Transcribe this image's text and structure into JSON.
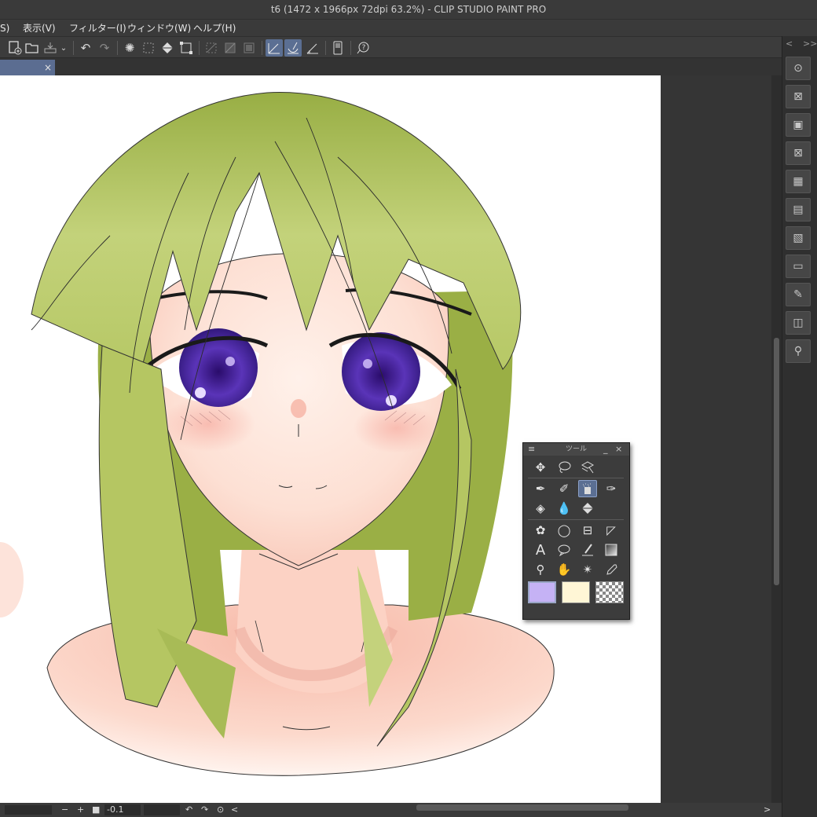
{
  "window": {
    "title": "t6 (1472 x 1966px 72dpi 63.2%)  - CLIP STUDIO PAINT PRO"
  },
  "menu": {
    "partial_first": "S)",
    "items": [
      "表示(V)",
      "フィルター(I)",
      "ウィンドウ(W)",
      "ヘルプ(H)"
    ]
  },
  "command_bar": {
    "icons": [
      "new-canvas-icon",
      "open-icon",
      "save-icon",
      "dropdown-icon",
      "undo-icon",
      "redo-icon",
      "loading-icon",
      "select-all-icon",
      "fill-icon",
      "transform-icon",
      "hide-selection-icon",
      "clear-icon",
      "fill-selection-icon",
      "snap-ruler-icon",
      "snap-special-ruler-icon",
      "snap-grid-icon",
      "device-icon",
      "help-icon"
    ]
  },
  "tab": {
    "close": "×"
  },
  "tool_palette": {
    "title": "ツール",
    "minimize": "_",
    "close": "×",
    "tools": [
      "move",
      "lasso-select",
      "layer-select",
      "pen",
      "pencil",
      "airbrush",
      "decoration",
      "eraser",
      "blend",
      "fill",
      "figure-gear",
      "figure-circle",
      "frame-border",
      "ruler",
      "text",
      "balloon",
      "correct-line",
      "gradient",
      "zoom",
      "hand",
      "auto-select",
      "eyedropper"
    ],
    "colors": {
      "main": "#c5b2f5",
      "sub": "#fff6d6",
      "transparent": "transparent"
    }
  },
  "status": {
    "zoom_minus": "−",
    "zoom_plus": "+",
    "value": "-0.1",
    "rotate_left": "↶",
    "rotate_right": "↷",
    "reset": "⊙",
    "scroll_left": "<",
    "scroll_right": ">"
  },
  "right_panel": {
    "nav_left": "<",
    "nav_right": ">>",
    "buttons": [
      "navigator-icon",
      "sub-view-icon",
      "material-icon",
      "material-2-icon",
      "material-3-icon",
      "material-4-icon",
      "material-5-icon",
      "material-6-icon",
      "material-7-icon",
      "material-8-icon",
      "figure-icon"
    ]
  },
  "colors": {
    "accent": "#5b6f93",
    "hair": "#9fb04a",
    "skin": "#fcd6c8",
    "eye": "#4b2a9b"
  }
}
